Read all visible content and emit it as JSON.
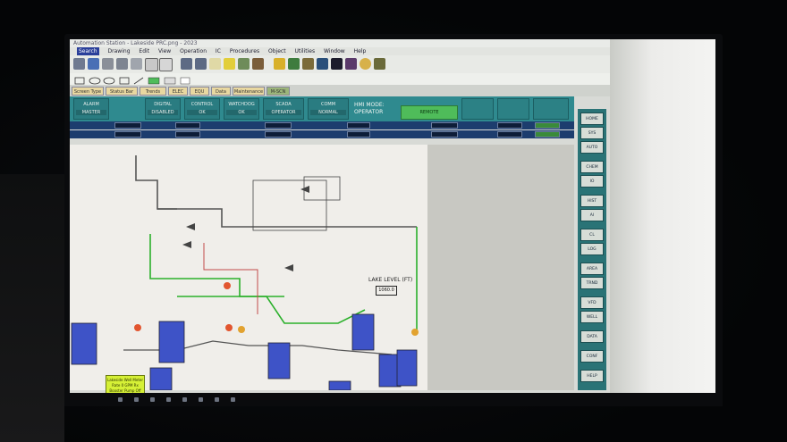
{
  "window": {
    "title": "Automation Station - Lakeside PRC.png - 2023"
  },
  "menu": [
    "Search",
    "Drawing",
    "Edit",
    "View",
    "Operation",
    "IC",
    "Procedures",
    "Object",
    "Utilities",
    "Window",
    "Help"
  ],
  "tabs": [
    "Screen Type B",
    "Status Bar",
    "Trends",
    "ELEC",
    "EQU",
    "Data",
    "Maintenance",
    "M-SCN"
  ],
  "status_boxes": [
    {
      "label": "ALARM",
      "value": "MASTER"
    },
    {
      "label": "DIGITAL",
      "value": "DISABLED"
    },
    {
      "label": "CONTROL",
      "value": "OK"
    },
    {
      "label": "WATCHDOG",
      "value": "OK"
    },
    {
      "label": "SCADA",
      "value": "OPERATOR"
    },
    {
      "label": "COMM",
      "value": "NORMAL"
    }
  ],
  "hmi_mode": {
    "label": "HMI MODE:",
    "value": "OPERATOR"
  },
  "mode_box": "REMOTE",
  "lake_level": {
    "label": "LAKE LEVEL (FT)",
    "value": "1060.0"
  },
  "alert_note": "Lakeside Well Meter Rate 0 GPM Rx Booster Pump Off",
  "right_buttons": [
    "HOME",
    "SYS",
    "AUTO",
    "CHEM",
    "IO",
    "HIST",
    "AI",
    "CL",
    "LOG",
    "AREA",
    "TRND",
    "VFD",
    "WELL",
    "DATA",
    "CONF",
    "HELP"
  ],
  "colors": {
    "teal": "#2f8a8f",
    "navy": "#1d3d6e",
    "green": "#4fbc5a",
    "pipe_green": "#2bb02b",
    "tank_blue": "#3e53c7"
  }
}
